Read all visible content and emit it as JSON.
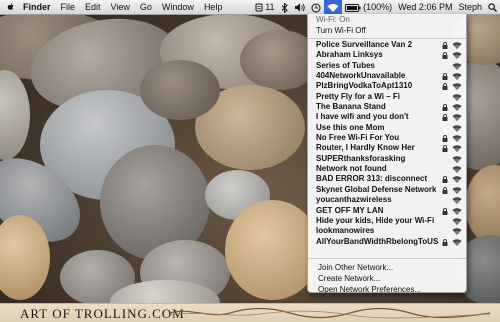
{
  "menubar": {
    "app": "Finder",
    "items": [
      {
        "label": "File"
      },
      {
        "label": "Edit"
      },
      {
        "label": "View"
      },
      {
        "label": "Go"
      },
      {
        "label": "Window"
      },
      {
        "label": "Help"
      }
    ],
    "status": {
      "script_badge": "11",
      "battery_percent": "(100%)",
      "datetime": "Wed 2:06 PM",
      "user": "Steph",
      "icons": [
        "script-menu-icon",
        "bluetooth-icon",
        "volume-icon",
        "timemachine-icon",
        "wifi-icon",
        "battery-icon",
        "spotlight-icon"
      ]
    }
  },
  "wifi_menu": {
    "status": "Wi-Fi: On",
    "turn_off": "Turn Wi-Fi Off",
    "networks": [
      {
        "name": "Police Surveillance Van 2",
        "locked": true
      },
      {
        "name": "Abraham Linksys",
        "locked": true
      },
      {
        "name": "Series of Tubes",
        "locked": false
      },
      {
        "name": "404NetworkUnavailable",
        "locked": true
      },
      {
        "name": "PlzBringVodkaToApt1310",
        "locked": true
      },
      {
        "name": "Pretty Fly for a Wi – Fi",
        "locked": false
      },
      {
        "name": "The Banana Stand",
        "locked": true
      },
      {
        "name": "I have wifi and you don't",
        "locked": true
      },
      {
        "name": "Use this one Mom",
        "locked": false
      },
      {
        "name": "No Free Wi-Fi For You",
        "locked": true
      },
      {
        "name": "Router, I Hardly Know Her",
        "locked": true
      },
      {
        "name": "SUPERthanksforasking",
        "locked": false
      },
      {
        "name": "Network not found",
        "locked": false
      },
      {
        "name": "BAD ERROR 313: disconnect",
        "locked": true
      },
      {
        "name": "Skynet Global Defense Network",
        "locked": true
      },
      {
        "name": "youcanthazwireless",
        "locked": false
      },
      {
        "name": "GET OFF MY LAN",
        "locked": true
      },
      {
        "name": "Hide your kids, Hide your Wi-Fi",
        "locked": false
      },
      {
        "name": "lookmanowires",
        "locked": false
      },
      {
        "name": "AllYourBandWidthRbelongToUS",
        "locked": true
      }
    ],
    "join_other": "Join Other Network...",
    "create_network": "Create Network...",
    "open_prefs": "Open Network Preferences..."
  },
  "watermark": "ART OF TROLLING.COM",
  "colors": {
    "menubar_bg": "#e6e6e6",
    "selected_status": "#3a67d6",
    "menu_bg": "#f8f8f8",
    "watermark_bg": "#e9ddc6"
  }
}
